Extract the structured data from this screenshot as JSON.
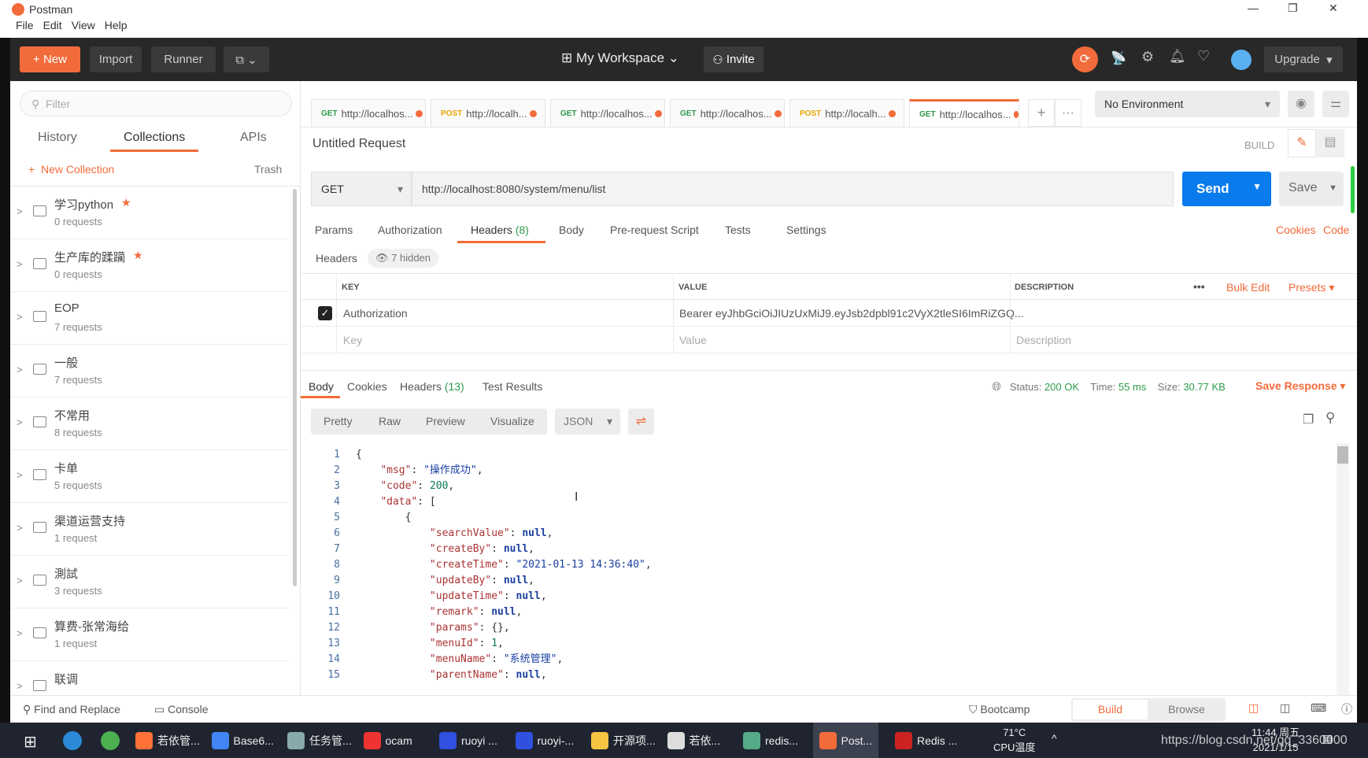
{
  "window": {
    "title": "Postman",
    "menu": [
      "File",
      "Edit",
      "View",
      "Help"
    ],
    "min": "—",
    "max": "❐",
    "close": "✕"
  },
  "toolbar": {
    "new": "New",
    "import": "Import",
    "runner": "Runner",
    "workspace": "My Workspace",
    "invite": "Invite",
    "upgrade": "Upgrade"
  },
  "sidebar": {
    "filter_placeholder": "Filter",
    "tabs": [
      "History",
      "Collections",
      "APIs"
    ],
    "active_tab": "Collections",
    "new_collection": "New Collection",
    "trash": "Trash",
    "collections": [
      {
        "name": "学习python",
        "count": "0 requests",
        "starred": true
      },
      {
        "name": "生产库的蹂躏",
        "count": "0 requests",
        "starred": true
      },
      {
        "name": "EOP",
        "count": "7 requests"
      },
      {
        "name": "一般",
        "count": "7 requests"
      },
      {
        "name": "不常用",
        "count": "8 requests"
      },
      {
        "name": "卡单",
        "count": "5 requests"
      },
      {
        "name": "渠道运营支持",
        "count": "1 request"
      },
      {
        "name": "測試",
        "count": "3 requests"
      },
      {
        "name": "算费-张常海给",
        "count": "1 request"
      },
      {
        "name": "联调",
        "count": ""
      }
    ]
  },
  "tabs": [
    {
      "method": "GET",
      "url": "http://localhos..."
    },
    {
      "method": "POST",
      "url": "http://localh..."
    },
    {
      "method": "GET",
      "url": "http://localhos..."
    },
    {
      "method": "GET",
      "url": "http://localhos..."
    },
    {
      "method": "POST",
      "url": "http://localh..."
    },
    {
      "method": "GET",
      "url": "http://localhos...",
      "active": true
    }
  ],
  "environment": "No Environment",
  "request": {
    "title": "Untitled Request",
    "build": "BUILD",
    "method": "GET",
    "url": "http://localhost:8080/system/menu/list",
    "send": "Send",
    "save": "Save",
    "tabs": [
      "Params",
      "Authorization",
      "Headers",
      "Body",
      "Pre-request Script",
      "Tests",
      "Settings"
    ],
    "headers_count": "(8)",
    "active_tab": "Headers",
    "cookies": "Cookies",
    "code": "Code",
    "headers_label": "Headers",
    "hidden": "7 hidden",
    "columns": [
      "KEY",
      "VALUE",
      "DESCRIPTION"
    ],
    "bulk_edit": "Bulk Edit",
    "presets": "Presets",
    "rows": [
      {
        "checked": true,
        "key": "Authorization",
        "value": "Bearer eyJhbGciOiJIUzUxMiJ9.eyJsb2dpbl91c2VyX2tleSI6ImRiZGQ...",
        "description": ""
      }
    ],
    "placeholders": {
      "key": "Key",
      "value": "Value",
      "description": "Description"
    }
  },
  "response": {
    "tabs": [
      "Body",
      "Cookies",
      "Headers",
      "Test Results"
    ],
    "headers_count": "(13)",
    "status_label": "Status:",
    "status": "200 OK",
    "time_label": "Time:",
    "time": "55 ms",
    "size_label": "Size:",
    "size": "30.77 KB",
    "save_response": "Save Response",
    "views": [
      "Pretty",
      "Raw",
      "Preview",
      "Visualize"
    ],
    "format": "JSON",
    "lines": [
      [
        {
          "t": "{"
        }
      ],
      [
        {
          "t": "    "
        },
        {
          "c": "k",
          "t": "\"msg\""
        },
        {
          "t": ": "
        },
        {
          "c": "s",
          "t": "\"操作成功\""
        },
        {
          "t": ","
        }
      ],
      [
        {
          "t": "    "
        },
        {
          "c": "k",
          "t": "\"code\""
        },
        {
          "t": ": "
        },
        {
          "c": "n",
          "t": "200"
        },
        {
          "t": ","
        }
      ],
      [
        {
          "t": "    "
        },
        {
          "c": "k",
          "t": "\"data\""
        },
        {
          "t": ": ["
        }
      ],
      [
        {
          "t": "        {"
        }
      ],
      [
        {
          "t": "            "
        },
        {
          "c": "k",
          "t": "\"searchValue\""
        },
        {
          "t": ": "
        },
        {
          "c": "nl",
          "t": "null"
        },
        {
          "t": ","
        }
      ],
      [
        {
          "t": "            "
        },
        {
          "c": "k",
          "t": "\"createBy\""
        },
        {
          "t": ": "
        },
        {
          "c": "nl",
          "t": "null"
        },
        {
          "t": ","
        }
      ],
      [
        {
          "t": "            "
        },
        {
          "c": "k",
          "t": "\"createTime\""
        },
        {
          "t": ": "
        },
        {
          "c": "s",
          "t": "\"2021-01-13 14:36:40\""
        },
        {
          "t": ","
        }
      ],
      [
        {
          "t": "            "
        },
        {
          "c": "k",
          "t": "\"updateBy\""
        },
        {
          "t": ": "
        },
        {
          "c": "nl",
          "t": "null"
        },
        {
          "t": ","
        }
      ],
      [
        {
          "t": "            "
        },
        {
          "c": "k",
          "t": "\"updateTime\""
        },
        {
          "t": ": "
        },
        {
          "c": "nl",
          "t": "null"
        },
        {
          "t": ","
        }
      ],
      [
        {
          "t": "            "
        },
        {
          "c": "k",
          "t": "\"remark\""
        },
        {
          "t": ": "
        },
        {
          "c": "nl",
          "t": "null"
        },
        {
          "t": ","
        }
      ],
      [
        {
          "t": "            "
        },
        {
          "c": "k",
          "t": "\"params\""
        },
        {
          "t": ": {},"
        }
      ],
      [
        {
          "t": "            "
        },
        {
          "c": "k",
          "t": "\"menuId\""
        },
        {
          "t": ": "
        },
        {
          "c": "n",
          "t": "1"
        },
        {
          "t": ","
        }
      ],
      [
        {
          "t": "            "
        },
        {
          "c": "k",
          "t": "\"menuName\""
        },
        {
          "t": ": "
        },
        {
          "c": "s",
          "t": "\"系统管理\""
        },
        {
          "t": ","
        }
      ],
      [
        {
          "t": "            "
        },
        {
          "c": "k",
          "t": "\"parentName\""
        },
        {
          "t": ": "
        },
        {
          "c": "nl",
          "t": "null"
        },
        {
          "t": ","
        }
      ]
    ]
  },
  "bottombar": {
    "find_replace": "Find and Replace",
    "console": "Console",
    "bootcamp": "Bootcamp",
    "build": "Build",
    "browse": "Browse"
  },
  "taskbar": {
    "apps": [
      "若依管...",
      "Base6...",
      "任务管...",
      "ocam",
      "ruoyi ...",
      "ruoyi-...",
      "开源项...",
      "若依...",
      "redis...",
      "Post...",
      "Redis ..."
    ],
    "temp": "71°C",
    "temp_label": "CPU温度",
    "time": "11:44 周五",
    "date": "2021/1/15",
    "watermark": "https://blog.csdn.net/qq_3360000"
  },
  "colors": {
    "accent": "#f26b3a",
    "send": "#097bed",
    "success": "#2e9a4a",
    "toolbar": "#282828"
  }
}
